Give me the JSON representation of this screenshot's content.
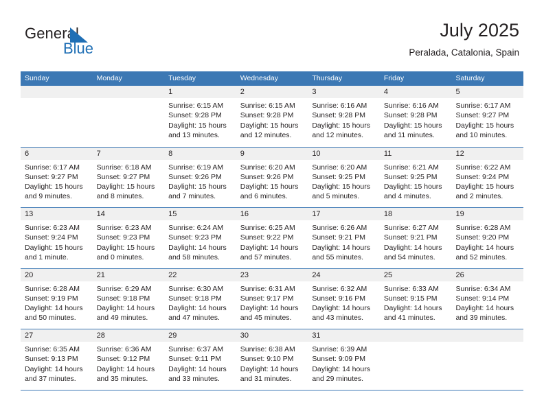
{
  "brand": {
    "name_part1": "General",
    "name_part2": "Blue",
    "triangle_color": "#1f6fb5"
  },
  "header": {
    "title": "July 2025",
    "subtitle": "Peralada, Catalonia, Spain"
  },
  "theme": {
    "header_blue": "#3c78b4",
    "day_band_gray": "#f0f0f0",
    "text": "#231f20"
  },
  "weekdays": [
    "Sunday",
    "Monday",
    "Tuesday",
    "Wednesday",
    "Thursday",
    "Friday",
    "Saturday"
  ],
  "weeks": [
    [
      {
        "day": "",
        "empty": true,
        "lines": []
      },
      {
        "day": "",
        "empty": true,
        "lines": []
      },
      {
        "day": "1",
        "lines": [
          "Sunrise: 6:15 AM",
          "Sunset: 9:28 PM",
          "Daylight: 15 hours",
          "and 13 minutes."
        ]
      },
      {
        "day": "2",
        "lines": [
          "Sunrise: 6:15 AM",
          "Sunset: 9:28 PM",
          "Daylight: 15 hours",
          "and 12 minutes."
        ]
      },
      {
        "day": "3",
        "lines": [
          "Sunrise: 6:16 AM",
          "Sunset: 9:28 PM",
          "Daylight: 15 hours",
          "and 12 minutes."
        ]
      },
      {
        "day": "4",
        "lines": [
          "Sunrise: 6:16 AM",
          "Sunset: 9:28 PM",
          "Daylight: 15 hours",
          "and 11 minutes."
        ]
      },
      {
        "day": "5",
        "lines": [
          "Sunrise: 6:17 AM",
          "Sunset: 9:27 PM",
          "Daylight: 15 hours",
          "and 10 minutes."
        ]
      }
    ],
    [
      {
        "day": "6",
        "lines": [
          "Sunrise: 6:17 AM",
          "Sunset: 9:27 PM",
          "Daylight: 15 hours",
          "and 9 minutes."
        ]
      },
      {
        "day": "7",
        "lines": [
          "Sunrise: 6:18 AM",
          "Sunset: 9:27 PM",
          "Daylight: 15 hours",
          "and 8 minutes."
        ]
      },
      {
        "day": "8",
        "lines": [
          "Sunrise: 6:19 AM",
          "Sunset: 9:26 PM",
          "Daylight: 15 hours",
          "and 7 minutes."
        ]
      },
      {
        "day": "9",
        "lines": [
          "Sunrise: 6:20 AM",
          "Sunset: 9:26 PM",
          "Daylight: 15 hours",
          "and 6 minutes."
        ]
      },
      {
        "day": "10",
        "lines": [
          "Sunrise: 6:20 AM",
          "Sunset: 9:25 PM",
          "Daylight: 15 hours",
          "and 5 minutes."
        ]
      },
      {
        "day": "11",
        "lines": [
          "Sunrise: 6:21 AM",
          "Sunset: 9:25 PM",
          "Daylight: 15 hours",
          "and 4 minutes."
        ]
      },
      {
        "day": "12",
        "lines": [
          "Sunrise: 6:22 AM",
          "Sunset: 9:24 PM",
          "Daylight: 15 hours",
          "and 2 minutes."
        ]
      }
    ],
    [
      {
        "day": "13",
        "lines": [
          "Sunrise: 6:23 AM",
          "Sunset: 9:24 PM",
          "Daylight: 15 hours",
          "and 1 minute."
        ]
      },
      {
        "day": "14",
        "lines": [
          "Sunrise: 6:23 AM",
          "Sunset: 9:23 PM",
          "Daylight: 15 hours",
          "and 0 minutes."
        ]
      },
      {
        "day": "15",
        "lines": [
          "Sunrise: 6:24 AM",
          "Sunset: 9:23 PM",
          "Daylight: 14 hours",
          "and 58 minutes."
        ]
      },
      {
        "day": "16",
        "lines": [
          "Sunrise: 6:25 AM",
          "Sunset: 9:22 PM",
          "Daylight: 14 hours",
          "and 57 minutes."
        ]
      },
      {
        "day": "17",
        "lines": [
          "Sunrise: 6:26 AM",
          "Sunset: 9:21 PM",
          "Daylight: 14 hours",
          "and 55 minutes."
        ]
      },
      {
        "day": "18",
        "lines": [
          "Sunrise: 6:27 AM",
          "Sunset: 9:21 PM",
          "Daylight: 14 hours",
          "and 54 minutes."
        ]
      },
      {
        "day": "19",
        "lines": [
          "Sunrise: 6:28 AM",
          "Sunset: 9:20 PM",
          "Daylight: 14 hours",
          "and 52 minutes."
        ]
      }
    ],
    [
      {
        "day": "20",
        "lines": [
          "Sunrise: 6:28 AM",
          "Sunset: 9:19 PM",
          "Daylight: 14 hours",
          "and 50 minutes."
        ]
      },
      {
        "day": "21",
        "lines": [
          "Sunrise: 6:29 AM",
          "Sunset: 9:18 PM",
          "Daylight: 14 hours",
          "and 49 minutes."
        ]
      },
      {
        "day": "22",
        "lines": [
          "Sunrise: 6:30 AM",
          "Sunset: 9:18 PM",
          "Daylight: 14 hours",
          "and 47 minutes."
        ]
      },
      {
        "day": "23",
        "lines": [
          "Sunrise: 6:31 AM",
          "Sunset: 9:17 PM",
          "Daylight: 14 hours",
          "and 45 minutes."
        ]
      },
      {
        "day": "24",
        "lines": [
          "Sunrise: 6:32 AM",
          "Sunset: 9:16 PM",
          "Daylight: 14 hours",
          "and 43 minutes."
        ]
      },
      {
        "day": "25",
        "lines": [
          "Sunrise: 6:33 AM",
          "Sunset: 9:15 PM",
          "Daylight: 14 hours",
          "and 41 minutes."
        ]
      },
      {
        "day": "26",
        "lines": [
          "Sunrise: 6:34 AM",
          "Sunset: 9:14 PM",
          "Daylight: 14 hours",
          "and 39 minutes."
        ]
      }
    ],
    [
      {
        "day": "27",
        "lines": [
          "Sunrise: 6:35 AM",
          "Sunset: 9:13 PM",
          "Daylight: 14 hours",
          "and 37 minutes."
        ]
      },
      {
        "day": "28",
        "lines": [
          "Sunrise: 6:36 AM",
          "Sunset: 9:12 PM",
          "Daylight: 14 hours",
          "and 35 minutes."
        ]
      },
      {
        "day": "29",
        "lines": [
          "Sunrise: 6:37 AM",
          "Sunset: 9:11 PM",
          "Daylight: 14 hours",
          "and 33 minutes."
        ]
      },
      {
        "day": "30",
        "lines": [
          "Sunrise: 6:38 AM",
          "Sunset: 9:10 PM",
          "Daylight: 14 hours",
          "and 31 minutes."
        ]
      },
      {
        "day": "31",
        "lines": [
          "Sunrise: 6:39 AM",
          "Sunset: 9:09 PM",
          "Daylight: 14 hours",
          "and 29 minutes."
        ]
      },
      {
        "day": "",
        "empty": true,
        "lines": []
      },
      {
        "day": "",
        "empty": true,
        "lines": []
      }
    ]
  ]
}
